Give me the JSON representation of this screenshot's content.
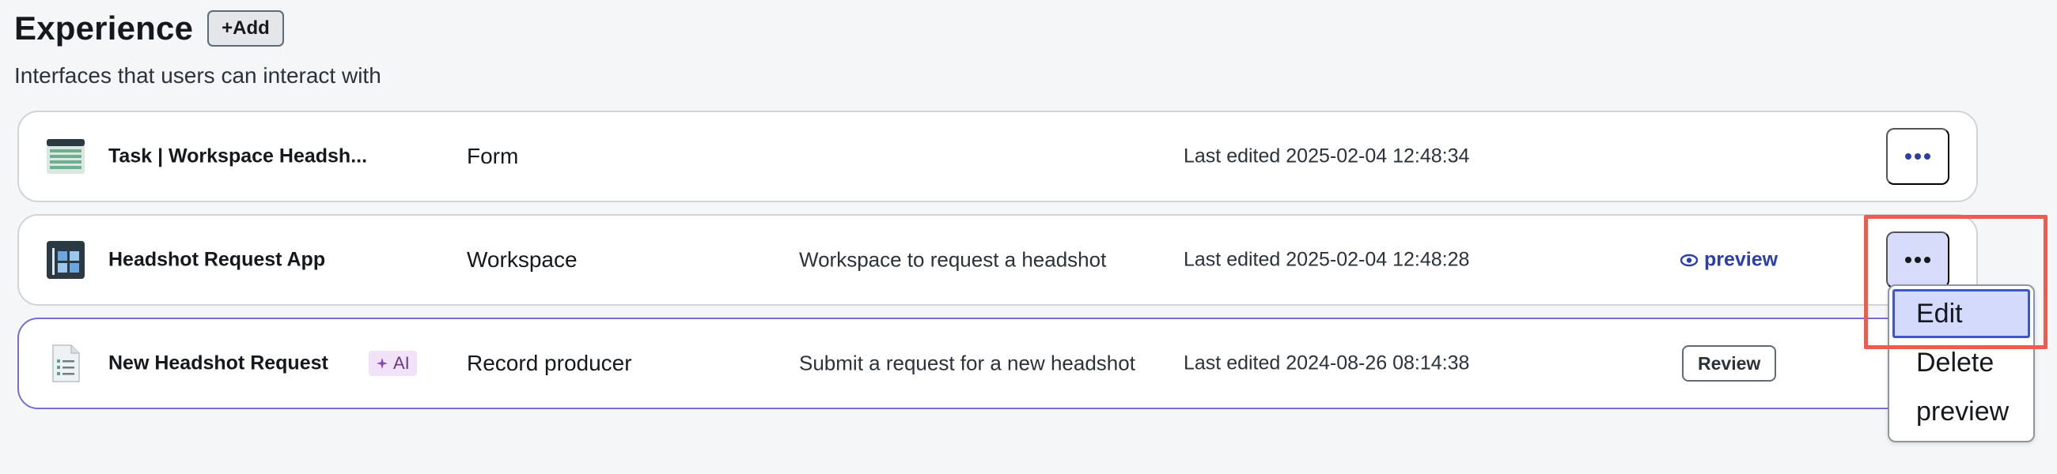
{
  "header": {
    "title": "Experience",
    "add_label": "+Add",
    "subtitle": "Interfaces that users can interact with"
  },
  "colors": {
    "accent": "#2c3fa6",
    "selected_border": "#7a6ad8",
    "highlight": "#ef5b4e",
    "menu_active_bg": "#d4dafb"
  },
  "rows": [
    {
      "name": "Task | Workspace Headsh...",
      "type": "Form",
      "description": "",
      "last_edited": "Last edited 2025-02-04 12:48:34",
      "icon": "table-icon"
    },
    {
      "name": "Headshot Request App",
      "type": "Workspace",
      "description": "Workspace to request a headshot",
      "last_edited": "Last edited 2025-02-04 12:48:28",
      "preview_label": "preview",
      "icon": "workspace-app-icon"
    },
    {
      "name": "New Headshot Request",
      "badge": "AI",
      "type": "Record producer",
      "description": "Submit a request for a new headshot",
      "last_edited": "Last edited 2024-08-26 08:14:38",
      "review_label": "Review",
      "icon": "document-list-icon"
    }
  ],
  "menu": {
    "items": [
      "Edit",
      "Delete",
      "preview"
    ],
    "active_index": 0
  }
}
